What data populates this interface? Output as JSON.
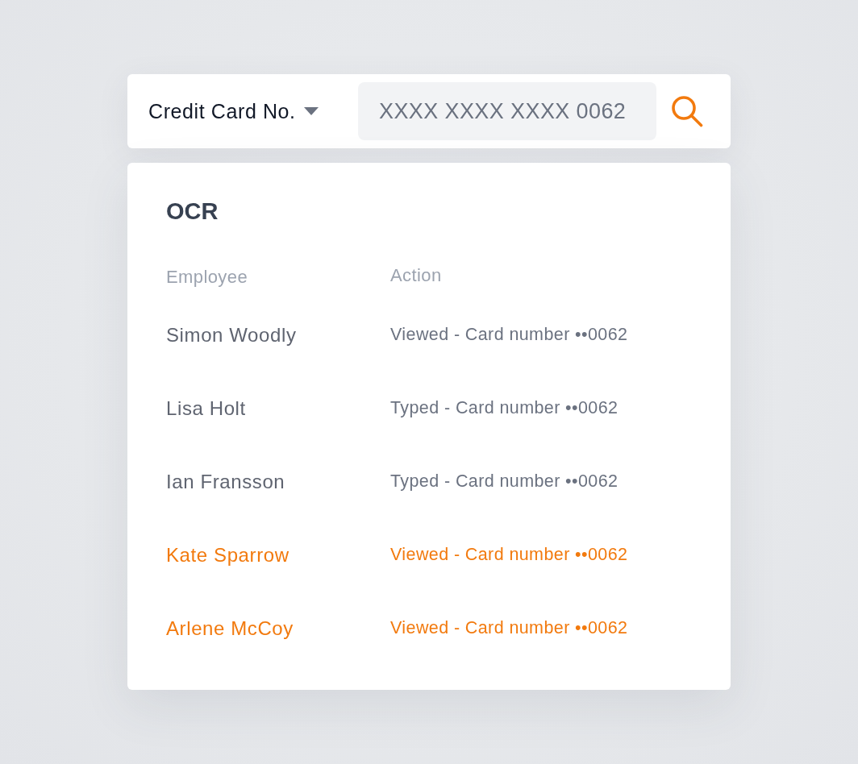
{
  "search_bar": {
    "field_selector": {
      "label": "Credit Card No."
    },
    "search_field": {
      "value": "XXXX XXXX XXXX 0062"
    }
  },
  "results": {
    "title": "OCR",
    "columns": [
      "Employee",
      "Action"
    ],
    "rows": [
      {
        "employee": "Simon Woodly",
        "action": "Viewed - Card number ••0062",
        "highlighted": false
      },
      {
        "employee": "Lisa Holt",
        "action": "Typed - Card number ••0062",
        "highlighted": false
      },
      {
        "employee": "Ian Fransson",
        "action": "Typed - Card number ••0062",
        "highlighted": false
      },
      {
        "employee": "Kate Sparrow",
        "action": "Viewed - Card number ••0062",
        "highlighted": true
      },
      {
        "employee": "Arlene McCoy",
        "action": "Viewed - Card number ••0062",
        "highlighted": true
      }
    ]
  }
}
